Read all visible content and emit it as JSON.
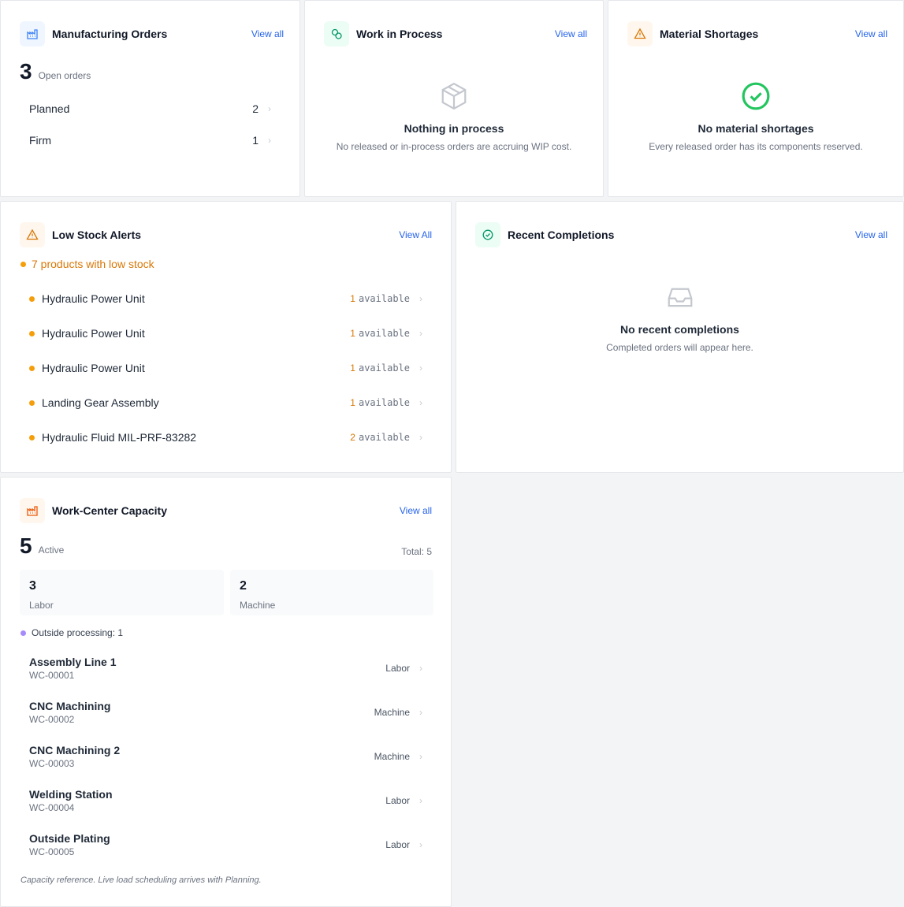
{
  "manufacturing_orders": {
    "title": "Manufacturing Orders",
    "view_all": "View all",
    "count": "3",
    "count_label": "Open orders",
    "rows": [
      {
        "label": "Planned",
        "value": "2"
      },
      {
        "label": "Firm",
        "value": "1"
      }
    ]
  },
  "work_in_process": {
    "title": "Work in Process",
    "view_all": "View all",
    "empty_title": "Nothing in process",
    "empty_sub": "No released or in-process orders are accruing WIP cost."
  },
  "material_shortages": {
    "title": "Material Shortages",
    "view_all": "View all",
    "empty_title": "No material shortages",
    "empty_sub": "Every released order has its components reserved."
  },
  "low_stock": {
    "title": "Low Stock Alerts",
    "view_all": "View All",
    "summary": "7 products with low stock",
    "items": [
      {
        "name": "Hydraulic Power Unit",
        "qty": "1",
        "unit": "available"
      },
      {
        "name": "Hydraulic Power Unit",
        "qty": "1",
        "unit": "available"
      },
      {
        "name": "Hydraulic Power Unit",
        "qty": "1",
        "unit": "available"
      },
      {
        "name": "Landing Gear Assembly",
        "qty": "1",
        "unit": "available"
      },
      {
        "name": "Hydraulic Fluid MIL-PRF-83282",
        "qty": "2",
        "unit": "available"
      }
    ]
  },
  "recent_completions": {
    "title": "Recent Completions",
    "view_all": "View all",
    "empty_title": "No recent completions",
    "empty_sub": "Completed orders will appear here."
  },
  "work_center": {
    "title": "Work-Center Capacity",
    "view_all": "View all",
    "count": "5",
    "count_label": "Active",
    "total": "Total: 5",
    "stats": [
      {
        "value": "3",
        "label": "Labor"
      },
      {
        "value": "2",
        "label": "Machine"
      }
    ],
    "outside": "Outside processing: 1",
    "rows": [
      {
        "name": "Assembly Line 1",
        "code": "WC-00001",
        "type": "Labor"
      },
      {
        "name": "CNC Machining",
        "code": "WC-00002",
        "type": "Machine"
      },
      {
        "name": "CNC Machining 2",
        "code": "WC-00003",
        "type": "Machine"
      },
      {
        "name": "Welding Station",
        "code": "WC-00004",
        "type": "Labor"
      },
      {
        "name": "Outside Plating",
        "code": "WC-00005",
        "type": "Labor"
      }
    ],
    "footer": "Capacity reference. Live load scheduling arrives with Planning."
  },
  "colors": {
    "accent": "#2563eb",
    "warning": "#d97706",
    "success": "#16a34a",
    "alert_dot": "#f59e0b",
    "outside_dot": "#a78bfa"
  },
  "icons": {
    "manufacturing": "factory-icon",
    "wip": "coins-icon",
    "shortages": "warning-triangle-icon",
    "low_stock": "warning-triangle-icon",
    "completions": "check-circle-icon",
    "work_center": "factory-icon",
    "empty_box": "box-icon",
    "empty_inbox": "inbox-icon",
    "success_check": "check-circle-icon"
  }
}
